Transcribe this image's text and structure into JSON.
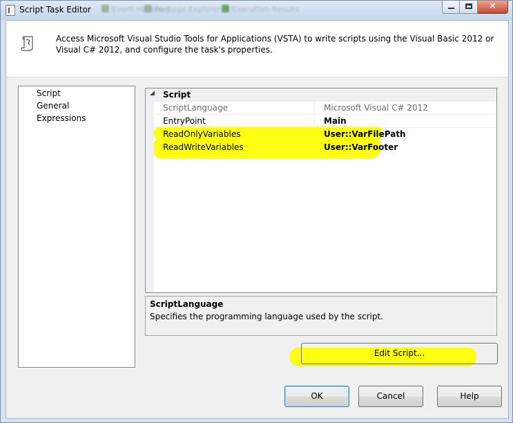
{
  "window": {
    "title": "Script Task Editor",
    "background_tabs": [
      "Event Handlers",
      "Package Explorer",
      "Execution Results"
    ],
    "caption_buttons": {
      "minimize": "minimize",
      "maximize": "maximize",
      "close": "✕"
    }
  },
  "header": {
    "description": "Access Microsoft Visual Studio Tools for Applications (VSTA) to write scripts using the Visual Basic 2012 or Visual C# 2012, and configure the task's properties."
  },
  "nav": {
    "items": [
      {
        "label": "Script"
      },
      {
        "label": "General"
      },
      {
        "label": "Expressions"
      }
    ]
  },
  "property_grid": {
    "category": "Script",
    "rows": [
      {
        "name": "ScriptLanguage",
        "value": "Microsoft Visual C# 2012",
        "readonly": true
      },
      {
        "name": "EntryPoint",
        "value": "Main",
        "readonly": false
      },
      {
        "name": "ReadOnlyVariables",
        "value": "User::VarFilePath",
        "readonly": false
      },
      {
        "name": "ReadWriteVariables",
        "value": "User::VarFooter",
        "readonly": false
      }
    ]
  },
  "description_pane": {
    "title": "ScriptLanguage",
    "body": "Specifies the programming language used by the script."
  },
  "buttons": {
    "edit_script": "Edit Script...",
    "ok": "OK",
    "cancel": "Cancel",
    "help": "Help"
  },
  "colors": {
    "highlight": "#ffff00",
    "window_frame": "#d6e2f0",
    "client_bg": "#f0f0f0"
  }
}
